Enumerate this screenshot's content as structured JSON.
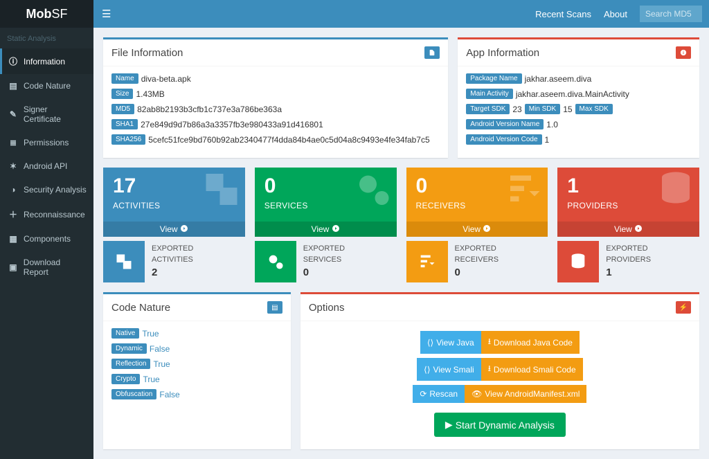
{
  "brand": {
    "a": "Mob",
    "b": "SF"
  },
  "sidebar": {
    "header": "Static Analysis",
    "items": [
      {
        "label": "Information"
      },
      {
        "label": "Code Nature"
      },
      {
        "label": "Signer Certificate"
      },
      {
        "label": "Permissions"
      },
      {
        "label": "Android API"
      },
      {
        "label": "Security Analysis"
      },
      {
        "label": "Reconnaissance"
      },
      {
        "label": "Components"
      },
      {
        "label": "Download Report"
      }
    ]
  },
  "topbar": {
    "recent": "Recent Scans",
    "about": "About",
    "search_placeholder": "Search MD5"
  },
  "file_info": {
    "title": "File Information",
    "name_tag": "Name",
    "name": "diva-beta.apk",
    "size_tag": "Size",
    "size": "1.43MB",
    "md5_tag": "MD5",
    "md5": "82ab8b2193b3cfb1c737e3a786be363a",
    "sha1_tag": "SHA1",
    "sha1": "27e849d9d7b86a3a3357fb3e980433a91d416801",
    "sha256_tag": "SHA256",
    "sha256": "5cefc51fce9bd760b92ab2340477f4dda84b4ae0c5d04a8c9493e4fe34fab7c5"
  },
  "app_info": {
    "title": "App Information",
    "pkg_tag": "Package Name",
    "pkg": "jakhar.aseem.diva",
    "main_tag": "Main Activity",
    "main": "jakhar.aseem.diva.MainActivity",
    "target_tag": "Target SDK",
    "target": "23",
    "min_tag": "Min SDK",
    "min": "15",
    "max_tag": "Max SDK",
    "ver_name_tag": "Android Version Name",
    "ver_name": "1.0",
    "ver_code_tag": "Android Version Code",
    "ver_code": "1"
  },
  "stats": {
    "view": "View",
    "activities": {
      "num": "17",
      "lbl": "ACTIVITIES",
      "exp_lbl1": "EXPORTED",
      "exp_lbl2": "ACTIVITIES",
      "exp_n": "2"
    },
    "services": {
      "num": "0",
      "lbl": "SERVICES",
      "exp_lbl1": "EXPORTED",
      "exp_lbl2": "SERVICES",
      "exp_n": "0"
    },
    "receivers": {
      "num": "0",
      "lbl": "RECEIVERS",
      "exp_lbl1": "EXPORTED",
      "exp_lbl2": "RECEIVERS",
      "exp_n": "0"
    },
    "providers": {
      "num": "1",
      "lbl": "PROVIDERS",
      "exp_lbl1": "EXPORTED",
      "exp_lbl2": "PROVIDERS",
      "exp_n": "1"
    }
  },
  "code_nature": {
    "title": "Code Nature",
    "native_tag": "Native",
    "native": "True",
    "dynamic_tag": "Dynamic",
    "dynamic": "False",
    "reflection_tag": "Reflection",
    "reflection": "True",
    "crypto_tag": "Crypto",
    "crypto": "True",
    "obf_tag": "Obfuscation",
    "obf": "False"
  },
  "options": {
    "title": "Options",
    "view_java": "View Java",
    "dl_java": "Download Java Code",
    "view_smali": "View Smali",
    "dl_smali": "Download Smali Code",
    "rescan": "Rescan",
    "view_manifest": "View AndroidManifest.xml",
    "start_dyn": "Start Dynamic Analysis"
  }
}
